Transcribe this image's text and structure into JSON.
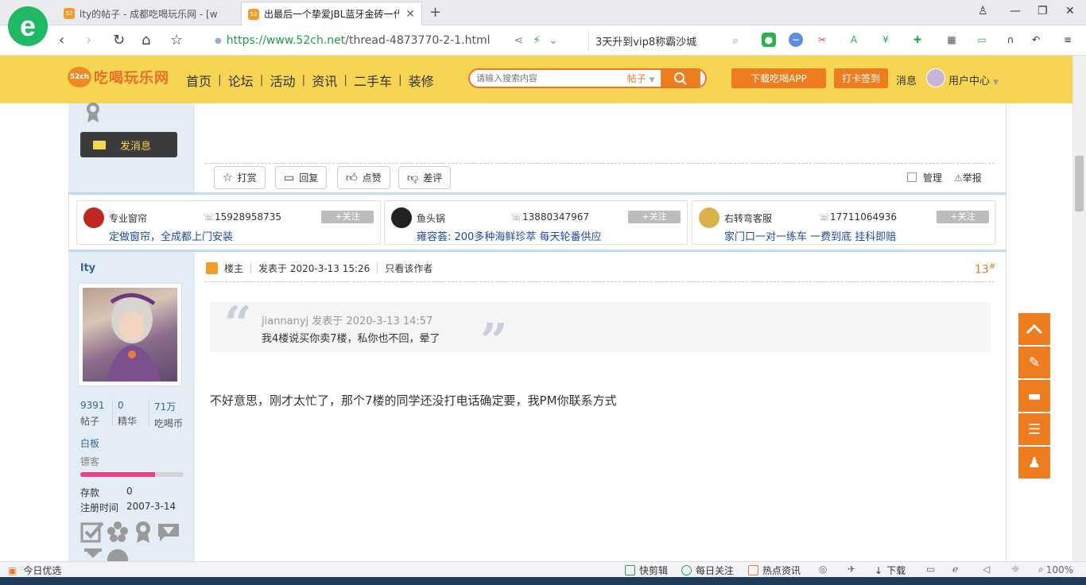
{
  "browser": {
    "logo_glyph": "e",
    "tabs": [
      {
        "label": "lty的帖子 - 成都吃喝玩乐网 - [w",
        "active": false
      },
      {
        "label": "出最后一个挚爱JBL蓝牙金砖一代",
        "active": true
      }
    ],
    "new_tab": "+",
    "url_secure": "https://www.52ch.net",
    "url_path": "/thread-4873770-2-1.html",
    "search_text": "3天升到vip8称霸沙城"
  },
  "site": {
    "logo_badge": "52ch",
    "logo_text": "吃喝玩乐网",
    "nav": [
      "首页",
      "论坛",
      "活动",
      "资讯",
      "二手车",
      "装修"
    ],
    "nav_sep": "|",
    "search_placeholder": "请输入搜索内容",
    "search_scope": "帖子",
    "download_app": "下载吃喝APP",
    "checkin": "打卡签到",
    "messages": "消息",
    "user_center": "用户中心"
  },
  "prev_post": {
    "send_message": "发消息",
    "actions": [
      "打赏",
      "回复",
      "点赞",
      "差评"
    ],
    "manage": "管理",
    "report": "举报"
  },
  "ads": [
    {
      "name": "专业窗帘",
      "phone": "15928958735",
      "follow": "+关注",
      "desc": "定做窗帘，全成都上门安装",
      "logo_color": "#c0271f"
    },
    {
      "name": "鱼头锅",
      "phone": "13880347967",
      "follow": "+关注",
      "desc": "雍容荟: 200多种海鲜珍萃 每天轮番供应",
      "logo_color": "#222222"
    },
    {
      "name": "右转弯客服",
      "phone": "17711064936",
      "follow": "+关注",
      "desc": "家门口一对一练车 一费到底 挂科即赔",
      "logo_color": "#d9b24a"
    }
  ],
  "poster": {
    "username": "lty",
    "stats": [
      {
        "value": "9391",
        "label": "帖子"
      },
      {
        "value": "0",
        "label": "精华"
      },
      {
        "value": "71万",
        "label": "吃喝币"
      }
    ],
    "rank": "白板",
    "title": "镖客",
    "rank_progress": 0.72,
    "deposit_label": "存款",
    "deposit_value": "0",
    "register_label": "注册时间",
    "register_value": "2007-3-14"
  },
  "post": {
    "role": "楼主",
    "posted_at": "发表于 2020-3-13 15:26",
    "only_author": "只看该作者",
    "floor": "13",
    "floor_suffix": "#",
    "quote_author": "jiannanyj 发表于 2020-3-13 14:57",
    "quote_text": "我4楼说买你卖7楼，私你也不回，晕了",
    "body": "不好意思，刚才太忙了，那个7楼的同学还没打电话确定要，我PM你联系方式"
  },
  "statusbar": {
    "left": "今日优选",
    "items": [
      "快剪辑",
      "每日关注",
      "热点资讯",
      "下载"
    ],
    "zoom": "100%"
  },
  "colors": {
    "header_yellow": "#f6d553",
    "accent_orange": "#ee7d1f",
    "link_blue": "#1f4a9e"
  }
}
